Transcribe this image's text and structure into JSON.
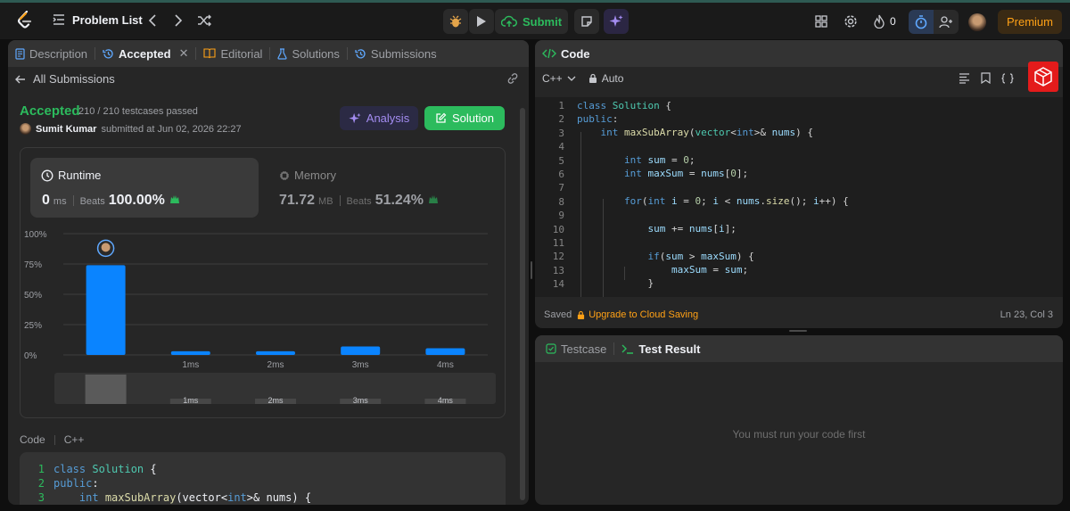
{
  "colors": {
    "accent_green": "#2cbb5d",
    "bar_blue": "#0a84ff",
    "premium_orange": "#ffa116",
    "purple": "#a38cf0"
  },
  "topbar": {
    "problem_list": "Problem List",
    "submit_label": "Submit",
    "streak_count": "0",
    "premium_label": "Premium"
  },
  "left_tabs": [
    {
      "label": "Description",
      "icon": "description-icon"
    },
    {
      "label": "Accepted",
      "icon": "history-icon"
    },
    {
      "label": "Editorial",
      "icon": "book-icon"
    },
    {
      "label": "Solutions",
      "icon": "flask-icon"
    },
    {
      "label": "Submissions",
      "icon": "history-icon"
    }
  ],
  "submission": {
    "back_label": "All Submissions",
    "status": "Accepted",
    "testcases": "210 / 210 testcases passed",
    "user": "Sumit Kumar",
    "submitted_at": "submitted at Jun 02, 2026 22:27",
    "analysis_label": "Analysis",
    "solution_label": "Solution"
  },
  "runtime": {
    "label": "Runtime",
    "value": "0",
    "unit": "ms",
    "beats_label": "Beats",
    "beats_value": "100.00%"
  },
  "memory": {
    "label": "Memory",
    "value": "71.72",
    "unit": "MB",
    "beats_label": "Beats",
    "beats_value": "51.24%"
  },
  "chart_data": {
    "type": "bar",
    "categories": [
      "0ms",
      "1ms",
      "2ms",
      "3ms",
      "4ms"
    ],
    "tick_labels": [
      "",
      "1ms",
      "2ms",
      "3ms",
      "4ms"
    ],
    "values": [
      74,
      3,
      3,
      7,
      5.5
    ],
    "yticks": [
      "100%",
      "75%",
      "50%",
      "25%",
      "0%"
    ],
    "ylim": [
      0,
      100
    ],
    "highlight_index": 0,
    "overview_labels": [
      "1ms",
      "2ms",
      "3ms",
      "4ms"
    ]
  },
  "code_preview": {
    "title": "Code",
    "lang": "C++",
    "lines": [
      {
        "n": "1",
        "text": "class Solution {"
      },
      {
        "n": "2",
        "text": "public:"
      },
      {
        "n": "3",
        "text": "    int maxSubArray(vector<int>& nums) {"
      }
    ]
  },
  "editor": {
    "title": "Code",
    "language": "C++",
    "mode": "Auto",
    "saved_label": "Saved",
    "upgrade_label": "Upgrade to Cloud Saving",
    "cursor": "Ln 23, Col 3",
    "line_numbers": [
      "1",
      "2",
      "3",
      "4",
      "5",
      "6",
      "7",
      "8",
      "9",
      "10",
      "11",
      "12",
      "13",
      "14"
    ]
  },
  "testpanel": {
    "tab_testcase": "Testcase",
    "tab_result": "Test Result",
    "empty_message": "You must run your code first"
  }
}
